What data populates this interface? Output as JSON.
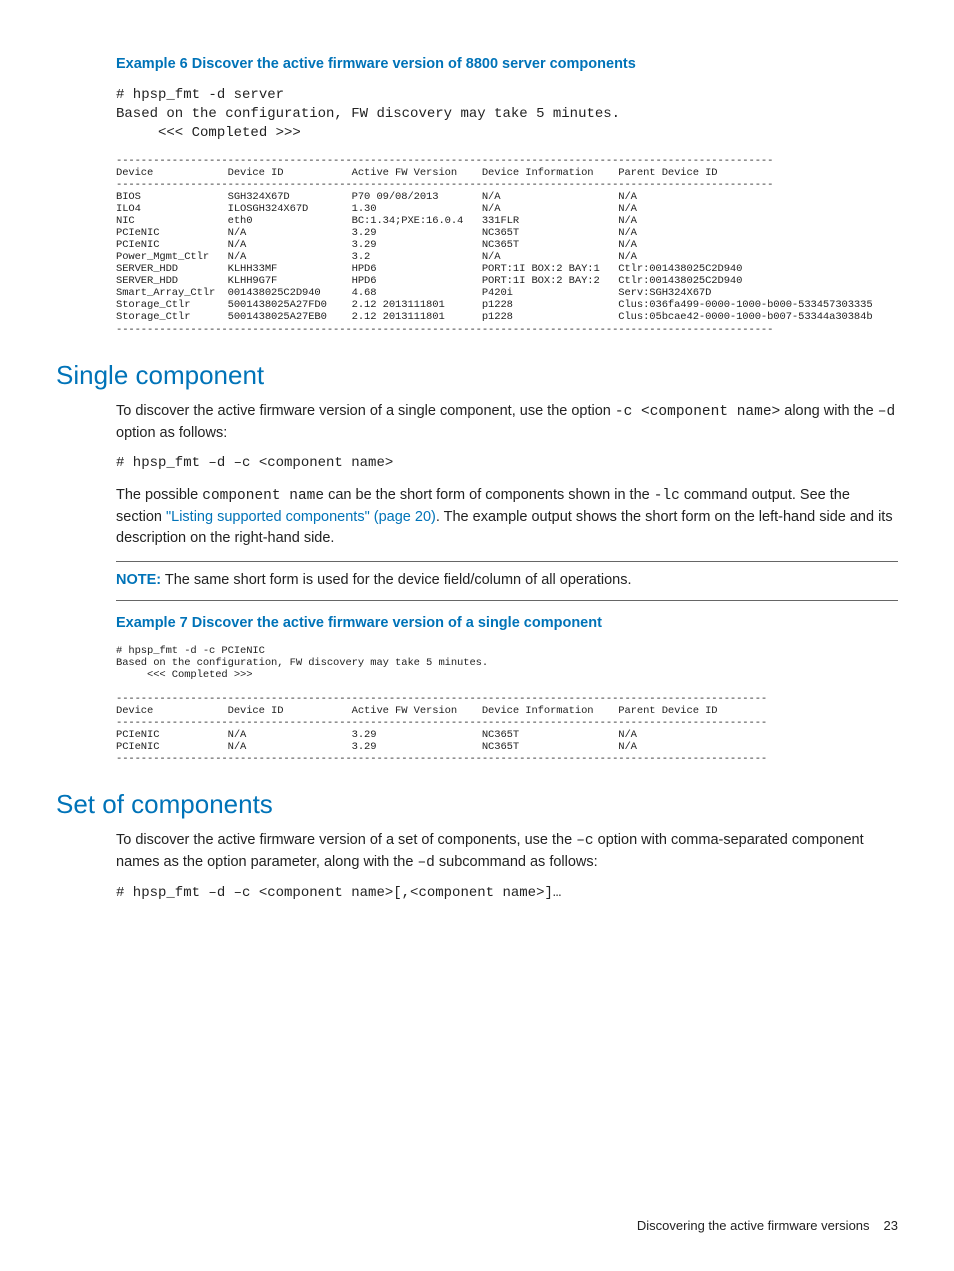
{
  "example6": {
    "title": "Example 6 Discover the active firmware version of 8800 server components",
    "cmd": "# hpsp_fmt -d server\nBased on the configuration, FW discovery may take 5 minutes.\n     <<< Completed >>>",
    "table": "----------------------------------------------------------------------------------------------------------\nDevice            Device ID           Active FW Version    Device Information    Parent Device ID\n----------------------------------------------------------------------------------------------------------\nBIOS              SGH324X67D          P70 09/08/2013       N/A                   N/A\nILO4              ILOSGH324X67D       1.30                 N/A                   N/A\nNIC               eth0                BC:1.34;PXE:16.0.4   331FLR                N/A\nPCIeNIC           N/A                 3.29                 NC365T                N/A\nPCIeNIC           N/A                 3.29                 NC365T                N/A\nPower_Mgmt_Ctlr   N/A                 3.2                  N/A                   N/A\nSERVER_HDD        KLHH33MF            HPD6                 PORT:1I BOX:2 BAY:1   Ctlr:001438025C2D940\nSERVER_HDD        KLHH9G7F            HPD6                 PORT:1I BOX:2 BAY:2   Ctlr:001438025C2D940\nSmart_Array_Ctlr  001438025C2D940     4.68                 P420i                 Serv:SGH324X67D\nStorage_Ctlr      5001438025A27FD0    2.12 2013111801      p1228                 Clus:036fa499-0000-1000-b000-533457303335\nStorage_Ctlr      5001438025A27EB0    2.12 2013111801      p1228                 Clus:05bcae42-0000-1000-b007-53344a30384b\n----------------------------------------------------------------------------------------------------------"
  },
  "single": {
    "heading": "Single component",
    "para1_a": "To discover the active firmware version of a single component, use the option ",
    "para1_code1": "-c <component name>",
    "para1_b": " along with the ",
    "para1_code2": "–d",
    "para1_c": " option as follows:",
    "cmd": "# hpsp_fmt –d –c <component name>",
    "para2_a": "The possible ",
    "para2_code1": "component name",
    "para2_b": " can be the short form of components shown in the ",
    "para2_code2": "-lc",
    "para2_c": " command output. See the section ",
    "link": "\"Listing supported components\" (page 20)",
    "para2_d": ". The example output shows the short form on the left-hand side and its description on the right-hand side.",
    "note_label": "NOTE:",
    "note_text": "   The same short form is used for the device field/column of all operations."
  },
  "example7": {
    "title": "Example 7 Discover the active firmware version of a single component",
    "out": "# hpsp_fmt -d -c PCIeNIC\nBased on the configuration, FW discovery may take 5 minutes.\n     <<< Completed >>>\n\n---------------------------------------------------------------------------------------------------------\nDevice            Device ID           Active FW Version    Device Information    Parent Device ID\n---------------------------------------------------------------------------------------------------------\nPCIeNIC           N/A                 3.29                 NC365T                N/A\nPCIeNIC           N/A                 3.29                 NC365T                N/A\n---------------------------------------------------------------------------------------------------------"
  },
  "set": {
    "heading": "Set of components",
    "para_a": "To discover the active firmware version of a set of components, use the ",
    "para_code1": "–c",
    "para_b": " option with comma-separated component names as the option parameter, along with the ",
    "para_code2": "–d",
    "para_c": " subcommand as follows:",
    "cmd": "# hpsp_fmt –d –c <component name>[,<component name>]…"
  },
  "footer": {
    "text": "Discovering the active firmware versions",
    "page": "23"
  }
}
